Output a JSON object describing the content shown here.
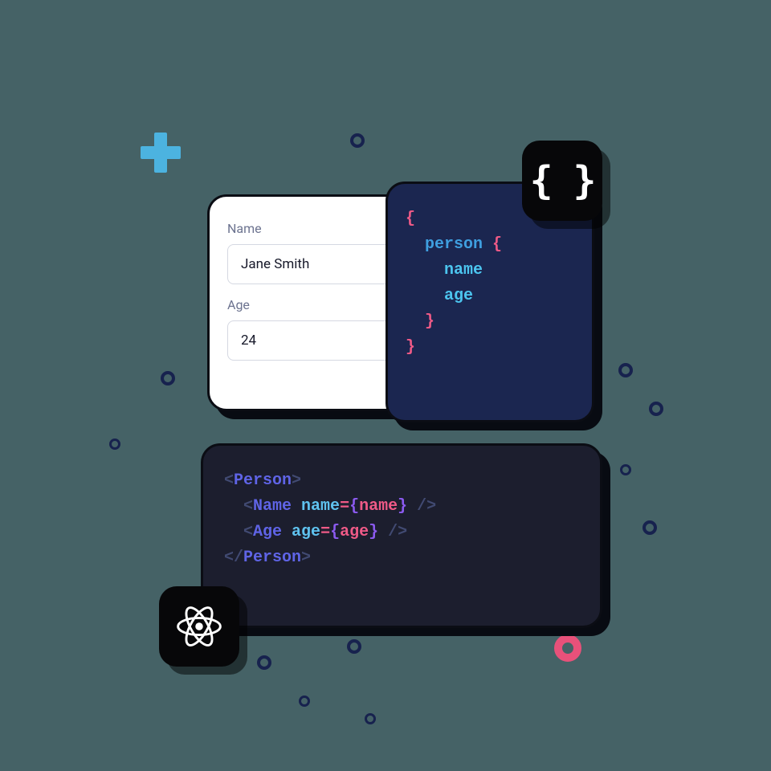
{
  "form": {
    "name_label": "Name",
    "name_value": "Jane Smith",
    "age_label": "Age",
    "age_value": "24"
  },
  "graphql": {
    "open_brace": "{",
    "entity": "person",
    "entity_brace": " {",
    "field_name": "name",
    "field_age": "age",
    "close_inner": "}",
    "close_outer": "}"
  },
  "jsx": {
    "line1_open": "<",
    "line1_tag": "Person",
    "line1_close": ">",
    "line2_open": "<",
    "line2_tag": "Name",
    "line2_attr": " name",
    "line2_eq": "=",
    "line2_expr_open": "{",
    "line2_expr": "name",
    "line2_expr_close": "}",
    "line2_selfclose": " />",
    "line3_open": "<",
    "line3_tag": "Age",
    "line3_attr": " age",
    "line3_eq": "=",
    "line3_expr_open": "{",
    "line3_expr": "age",
    "line3_expr_close": "}",
    "line3_selfclose": " />",
    "line4_open": "</",
    "line4_tag": "Person",
    "line4_close": ">"
  },
  "badges": {
    "graphql_glyph": "{ }",
    "react": "react-logo"
  },
  "colors": {
    "background": "#456266",
    "plus": "#4cb3e0",
    "dot": "#17224e",
    "pink": "#e8517a",
    "form_bg": "#ffffff",
    "gql_bg": "#1b2650",
    "jsx_bg": "#1c1e2e",
    "badge_bg": "#070709"
  }
}
